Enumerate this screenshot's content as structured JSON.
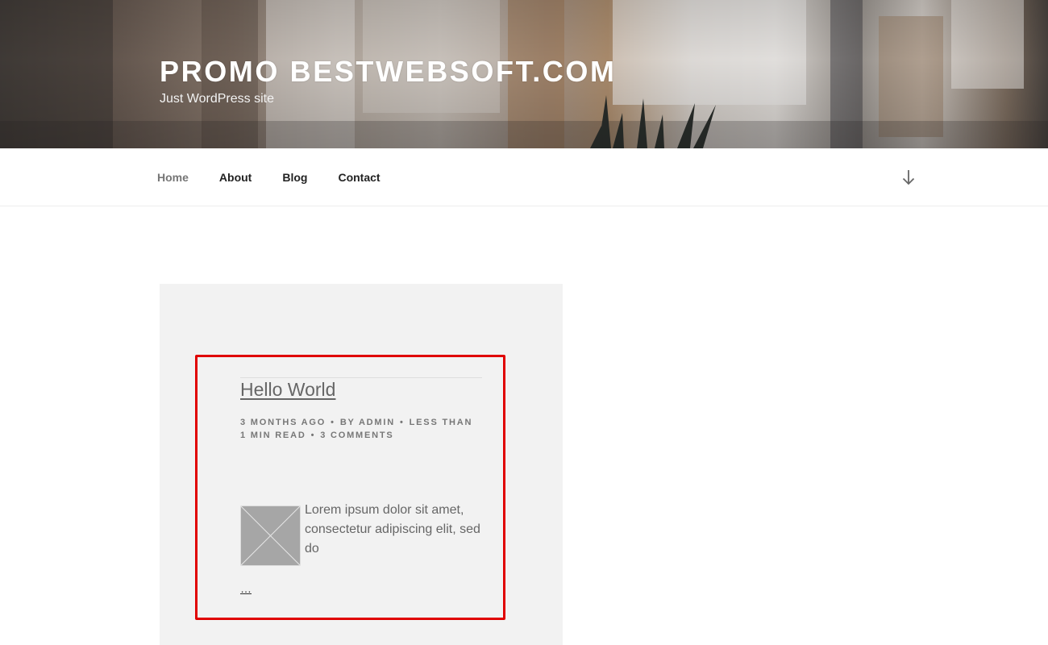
{
  "header": {
    "site_title": "PROMO BESTWEBSOFT.COM",
    "tagline": "Just WordPress site"
  },
  "nav": {
    "items": [
      {
        "label": "Home",
        "current": true
      },
      {
        "label": "About",
        "current": false
      },
      {
        "label": "Blog",
        "current": false
      },
      {
        "label": "Contact",
        "current": false
      }
    ],
    "scroll_icon": "arrow-down-icon"
  },
  "post": {
    "title": "Hello World",
    "meta": {
      "date": "3 MONTHS AGO",
      "author": "BY ADMIN",
      "read_time": "LESS THAN 1 MIN READ",
      "comments": "3 COMMENTS",
      "separator": "•"
    },
    "thumbnail_icon": "image-placeholder-icon",
    "excerpt": "Lorem ipsum dolor sit amet, consectetur adipiscing elit, sed do",
    "more_link": "…"
  },
  "colors": {
    "highlight_border": "#e00000",
    "card_background": "#f2f2f2",
    "thumbnail": "#a6a6a6"
  }
}
